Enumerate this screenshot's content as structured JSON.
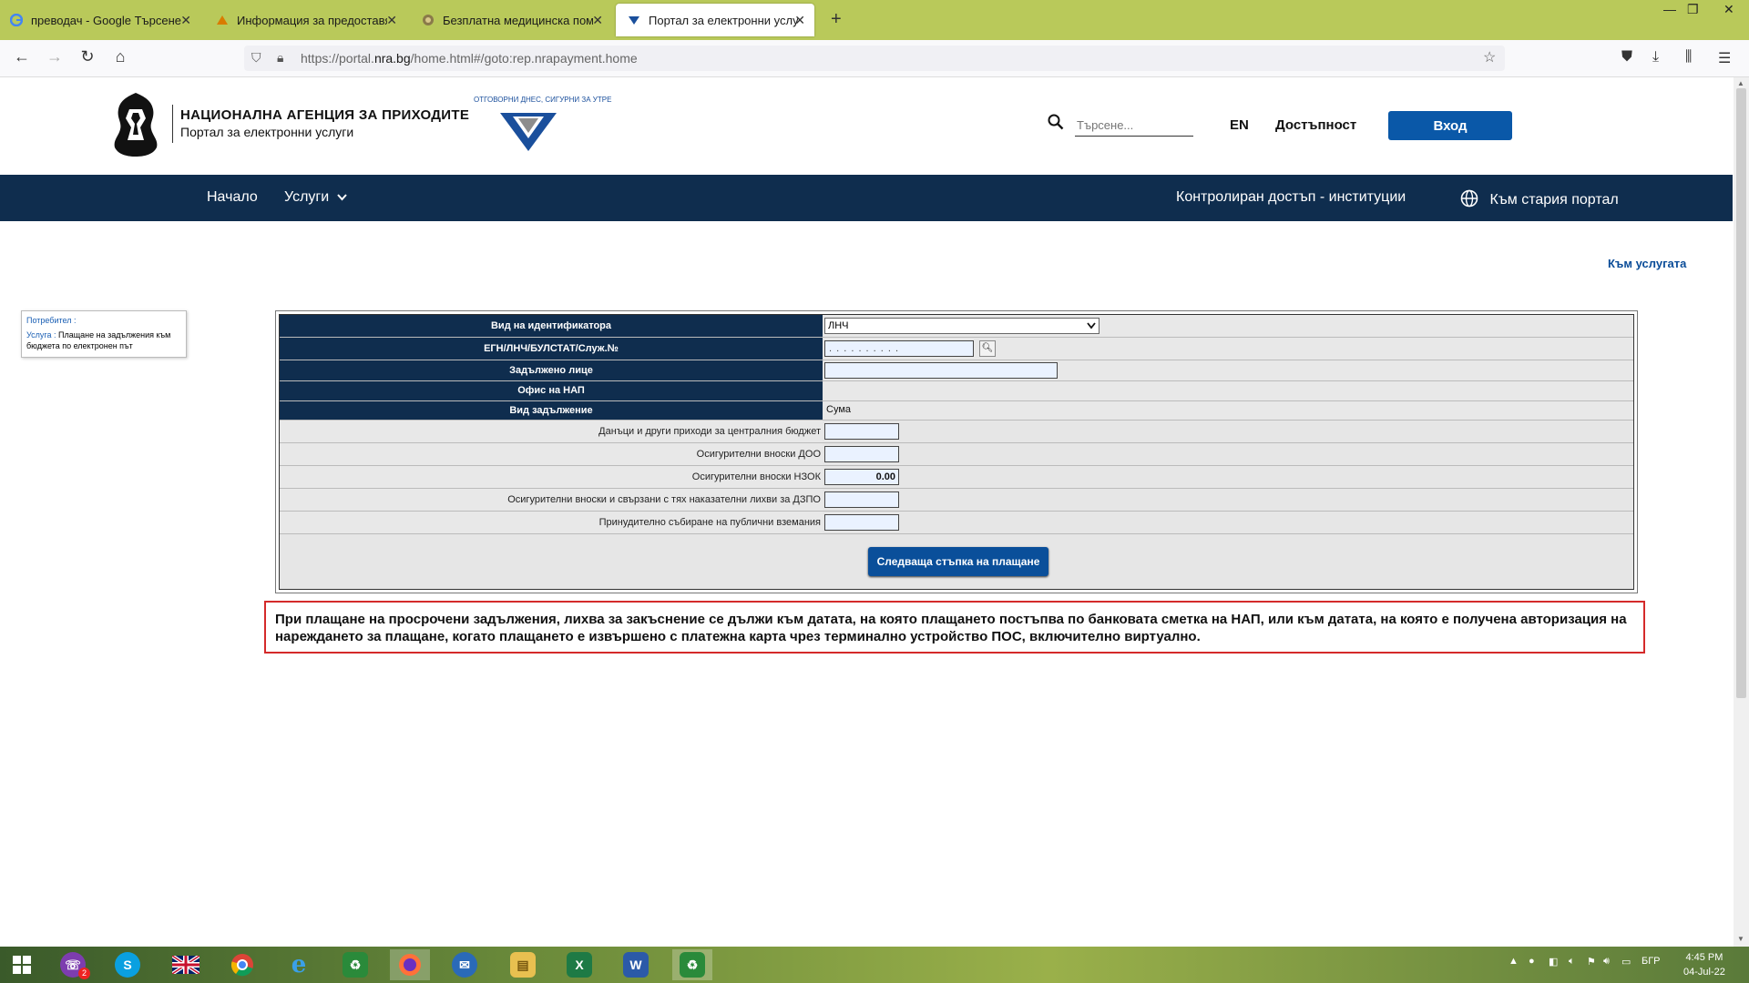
{
  "browser": {
    "tabs": [
      {
        "title": "преводач - Google Търсене",
        "icon": "google-icon"
      },
      {
        "title": "Информация за предоставяне",
        "icon": "gov-icon"
      },
      {
        "title": "Безплатна медицинска помощ",
        "icon": "medical-icon"
      },
      {
        "title": "Портал за електронни услуги",
        "icon": "nra-icon"
      }
    ],
    "url_prefix": "https://portal.",
    "url_domain": "nra.bg",
    "url_suffix": "/home.html#/goto:rep.nrapayment.home"
  },
  "header": {
    "agency_name": "НАЦИОНАЛНА АГЕНЦИЯ ЗА ПРИХОДИТЕ",
    "portal_name": "Портал за електронни услуги",
    "motto": "ОТГОВОРНИ ДНЕС, СИГУРНИ ЗА УТРЕ",
    "search_placeholder": "Търсене...",
    "lang": "EN",
    "accessibility": "Достъпност",
    "login": "Вход"
  },
  "nav": {
    "home": "Начало",
    "services": "Услуги",
    "controlled_access": "Контролиран достъп - институции",
    "old_portal": "Към стария портал"
  },
  "to_service": "Към услугата",
  "userbox": {
    "user_label": "Потребител :",
    "service_label": "Услуга :",
    "service_value": "Плащане на задължения към бюджета по електронен път"
  },
  "form": {
    "id_type_label": "Вид на идентификатора",
    "id_type_value": "ЛНЧ",
    "id_label": "ЕГН/ЛНЧ/БУЛСТАТ/Служ.№",
    "id_value": ". . . . . . . . . .",
    "obligor_label": "Задължено лице",
    "office_label": "Офис на НАП",
    "liability_type_label": "Вид задължение",
    "amount_header": "Сума",
    "rows": [
      {
        "label": "Данъци и други приходи за централния бюджет",
        "value": ""
      },
      {
        "label": "Осигурителни вноски ДОО",
        "value": ""
      },
      {
        "label": "Осигурителни вноски НЗОК",
        "value": "0.00"
      },
      {
        "label": "Осигурителни вноски и свързани с тях наказателни лихви за ДЗПО",
        "value": ""
      },
      {
        "label": "Принудително събиране на публични вземания",
        "value": ""
      }
    ],
    "next_button": "Следваща стъпка на плащане"
  },
  "notice": "При плащане на просрочени задължения, лихва за закъснение се дължи към датата, на която плащането постъпва по банковата сметка на НАП, или към датата, на която е получена авторизация на нареждането за плащане, когато плащането е извършено с платежна карта чрез терминално устройство ПОС, включително виртуално.",
  "taskbar": {
    "viber_badge": "2",
    "lang": "БГР",
    "time": "4:45 PM",
    "date": "04-Jul-22"
  }
}
